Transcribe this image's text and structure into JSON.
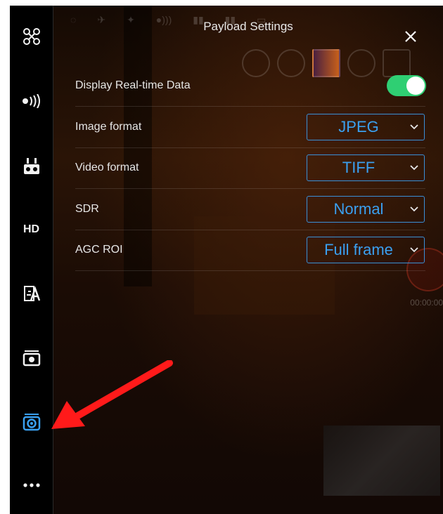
{
  "panel": {
    "title": "Payload Settings"
  },
  "settings": {
    "realtime_label": "Display Real-time Data",
    "realtime_on": true,
    "image_format_label": "Image format",
    "image_format_value": "JPEG",
    "video_format_label": "Video format",
    "video_format_value": "TIFF",
    "sdr_label": "SDR",
    "sdr_value": "Normal",
    "agc_roi_label": "AGC ROI",
    "agc_roi_value": "Full frame"
  },
  "sidebar": {
    "items": [
      {
        "name": "aircraft-icon"
      },
      {
        "name": "signal-icon"
      },
      {
        "name": "remote-controller-icon"
      },
      {
        "name": "hd-label",
        "label": "HD"
      },
      {
        "name": "map-translate-icon"
      },
      {
        "name": "camera-icon"
      },
      {
        "name": "payload-settings-icon",
        "active": true
      },
      {
        "name": "more-icon"
      }
    ]
  },
  "colors": {
    "accent": "#3aa0f0",
    "toggle_on": "#2fcf73",
    "annotation": "#ff1a1a"
  }
}
